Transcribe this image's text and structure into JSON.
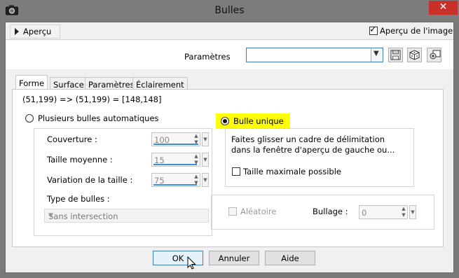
{
  "window": {
    "title": "Bulles",
    "close_symbol": "✕"
  },
  "preview_bar": {
    "apercu_label": "Aperçu",
    "preview_checkbox_label": "Aperçu de l'image",
    "preview_checked": true
  },
  "presets": {
    "label": "Paramètres",
    "value": "",
    "tools": [
      "save-preset-icon",
      "randomize-icon",
      "preset-options-icon"
    ]
  },
  "tabs": [
    "Forme",
    "Surface",
    "Paramètres",
    "Éclairement"
  ],
  "active_tab": "Forme",
  "status_text": "(51,199) => (51,199) = [148,148]",
  "auto_bubbles": {
    "radio_label": "Plusieurs bulles automatiques",
    "selected": false,
    "coverage_label": "Couverture :",
    "coverage_value": "100",
    "size_label": "Taille moyenne :",
    "size_value": "15",
    "variation_label": "Variation de la taille :",
    "variation_value": "75",
    "type_label": "Type de bulles :",
    "type_value": "Sans intersection"
  },
  "single_bubble": {
    "radio_label": "Bulle unique",
    "selected": true,
    "hint": "Faites glisser un cadre de délimitation dans la fenêtre d'aperçu de gauche ou...",
    "max_size_label": "Taille maximale possible",
    "max_size_checked": false
  },
  "random": {
    "label": "Aléatoire",
    "checked": false
  },
  "bubbling": {
    "label": "Bullage :",
    "value": "0"
  },
  "buttons": {
    "ok": "OK",
    "cancel": "Annuler",
    "help": "Aide"
  },
  "colors": {
    "title_bar": "#7c7c7c",
    "close": "#c9302a",
    "highlight": "#ffff00",
    "accent": "#3a8ee0"
  }
}
